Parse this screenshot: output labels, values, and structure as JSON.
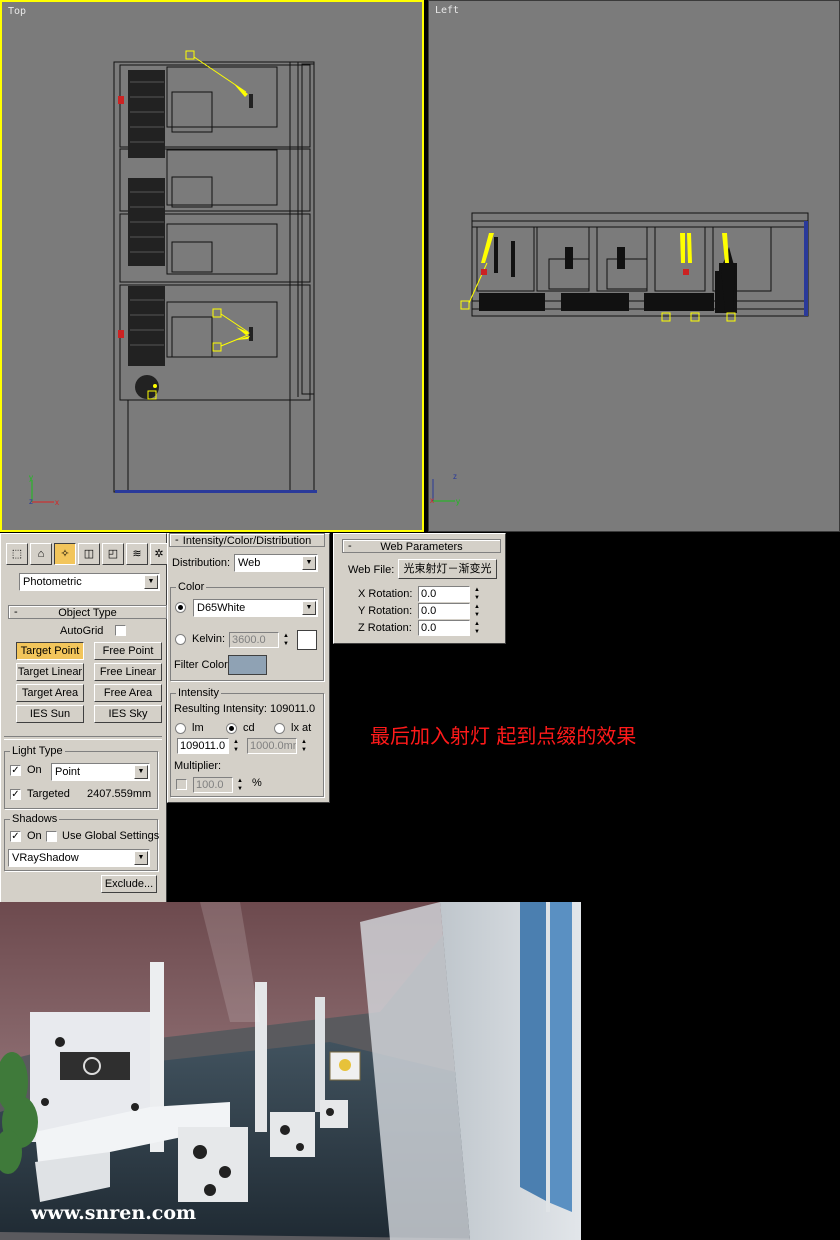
{
  "viewports": {
    "top_label": "Top",
    "left_label": "Left"
  },
  "command_panel": {
    "toolbar_icons": [
      "create-geometry-icon",
      "create-shapes-icon",
      "create-lights-icon",
      "create-cameras-icon",
      "create-helpers-icon",
      "create-spacewarps-icon",
      "create-systems-icon"
    ],
    "category": "Photometric"
  },
  "object_type": {
    "header": "Object Type",
    "autogrid_label": "AutoGrid",
    "buttons": [
      "Target Point",
      "Free Point",
      "Target Linear",
      "Free Linear",
      "Target Area",
      "Free Area",
      "IES Sun",
      "IES Sky"
    ],
    "active": "Target Point"
  },
  "light_type": {
    "title": "Light Type",
    "on_label": "On",
    "type_value": "Point",
    "targeted_label": "Targeted",
    "target_distance": "2407.559mm"
  },
  "shadows": {
    "title": "Shadows",
    "on_label": "On",
    "global_label": "Use Global Settings",
    "type_value": "VRayShadow",
    "exclude_label": "Exclude..."
  },
  "intensity_panel": {
    "header": "Intensity/Color/Distribution",
    "distribution_label": "Distribution:",
    "distribution_value": "Web",
    "color_title": "Color",
    "color_preset": "D65White",
    "kelvin_label": "Kelvin:",
    "kelvin_value": "3600.0",
    "filter_label": "Filter Color:",
    "intensity_title": "Intensity",
    "resulting_label": "Resulting Intensity: 109011.0",
    "unit_lm": "lm",
    "unit_cd": "cd",
    "unit_lx": "lx at",
    "intensity_value": "109011.0",
    "lx_distance": "1000.0mm",
    "multiplier_label": "Multiplier:",
    "multiplier_value": "100.0",
    "percent": "%"
  },
  "web_parameters": {
    "header": "Web Parameters",
    "web_file_label": "Web File:",
    "web_file_value": "光束射灯－渐变光",
    "x_label": "X Rotation:",
    "x_value": "0.0",
    "y_label": "Y Rotation:",
    "y_value": "0.0",
    "z_label": "Z Rotation:",
    "z_value": "0.0"
  },
  "caption": "最后加入射灯 起到点缀的效果",
  "render": {
    "watermark": "www.snren.com"
  },
  "colors": {
    "viewport_bg": "#7b7b7b",
    "active_border": "#ffff00",
    "ui_gray": "#d4d0c8",
    "active_button": "#f2c55b",
    "caption_red": "#ff1a1a",
    "filter_color": "#8fa2b4"
  }
}
